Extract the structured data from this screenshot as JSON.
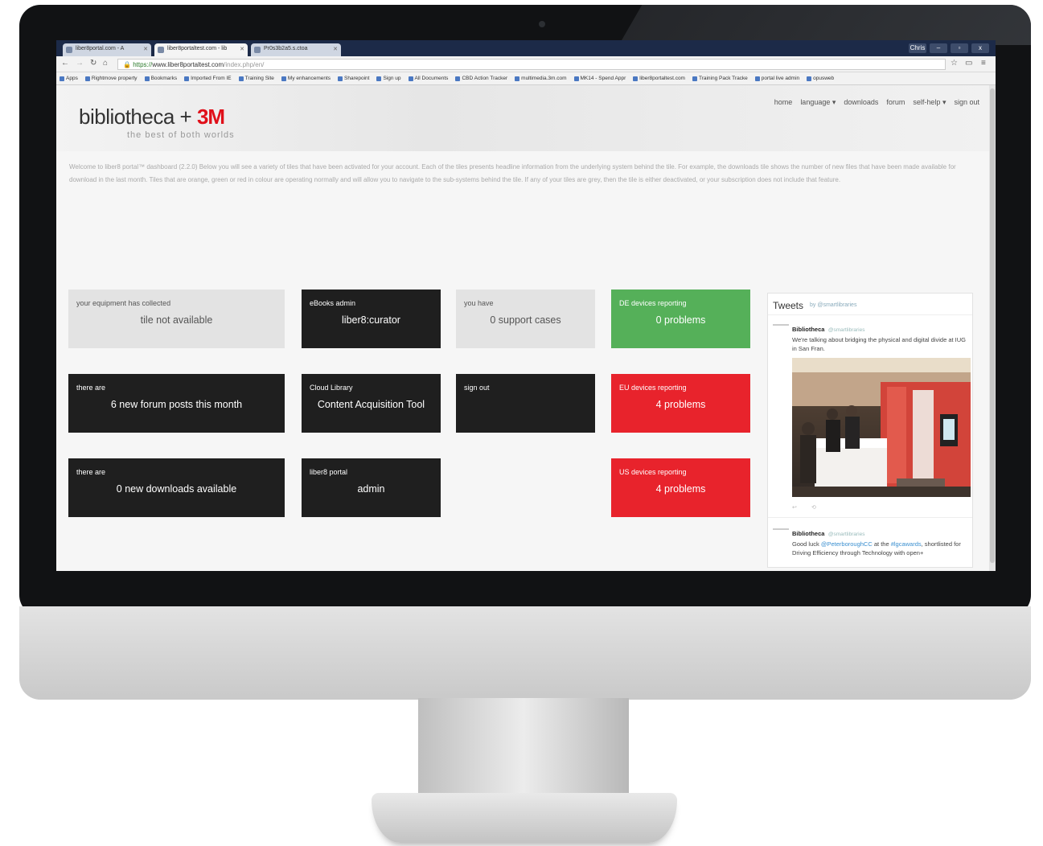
{
  "browser": {
    "tabs": [
      {
        "label": "liber8portal.com - A"
      },
      {
        "label": "liber8portaltest.com - lib"
      },
      {
        "label": "Pr0s3b2a5.s.ctoa"
      }
    ],
    "window_controls": [
      "Chris",
      "–",
      "▫",
      "x"
    ],
    "url_secure": "https://",
    "url_host": "www.liber8portaltest.com",
    "url_path": "/index.php/en/",
    "bookmarks": [
      "Apps",
      "Rightmove property",
      "Bookmarks",
      "Imported From IE",
      "Training Site",
      "My enhancements",
      "Sharepoint",
      "Sign up",
      "All Documents",
      "CBD Action Tracker",
      "multimedia.3m.com",
      "MK14 - Spend Appr",
      "liber8portaltest.com",
      "Training Pack Tracke",
      "portal live admin",
      "opusweb"
    ]
  },
  "header": {
    "logo_text": "bibliotheca + ",
    "logo_brand": "3M",
    "tagline": "the best of both worlds",
    "nav": [
      "home",
      "language ▾",
      "downloads",
      "forum",
      "self-help ▾",
      "sign out"
    ]
  },
  "intro": "Welcome to liber8 portal™ dashboard (2.2.0) Below you will see a variety of tiles that have been activated for your account. Each of the tiles presents headline information from the underlying system behind the tile. For example, the downloads tile shows the number of new files that have been made available for download in the last month. Tiles that are orange, green or red in colour are operating normally and will allow you to navigate to the sub-systems behind the tile. If any of your tiles are grey, then the tile is either deactivated, or your subscription does not include that feature.",
  "tiles": {
    "equipment": {
      "label": "your equipment has collected",
      "value": "tile not available"
    },
    "ebooks": {
      "label": "eBooks admin",
      "value": "liber8:curator"
    },
    "support": {
      "label": "you have",
      "value": "0 support cases"
    },
    "de": {
      "label": "DE devices reporting",
      "value": "0 problems"
    },
    "forum": {
      "label": "there are",
      "value": "6 new forum posts this month"
    },
    "cloud": {
      "label": "Cloud Library",
      "value": "Content Acquisition Tool"
    },
    "signout": {
      "label": "sign out",
      "value": ""
    },
    "eu": {
      "label": "EU devices reporting",
      "value": "4 problems"
    },
    "downloads": {
      "label": "there are",
      "value": "0 new downloads available"
    },
    "portal": {
      "label": "liber8 portal",
      "value": "admin"
    },
    "us": {
      "label": "US devices reporting",
      "value": "4 problems"
    }
  },
  "tweets": {
    "title": "Tweets",
    "by": "by @smartlibraries",
    "items": [
      {
        "author": "Bibliotheca",
        "handle": "@smartlibraries",
        "text": "We're talking about bridging the physical and digital divide at IUG in San Fran."
      },
      {
        "author": "Bibliotheca",
        "handle": "@smartlibraries",
        "text_a": "Good luck ",
        "link_a": "@PeterboroughCC",
        "text_b": " at the ",
        "link_b": "#lgcawards",
        "text_c": ", shortlisted for Driving Efficiency through Technology with open+"
      }
    ]
  },
  "colors": {
    "red": "#e8232c",
    "green": "#55b059",
    "dark": "#1f1f1f",
    "grey": "#e3e3e3",
    "brand3m": "#e0101a"
  }
}
